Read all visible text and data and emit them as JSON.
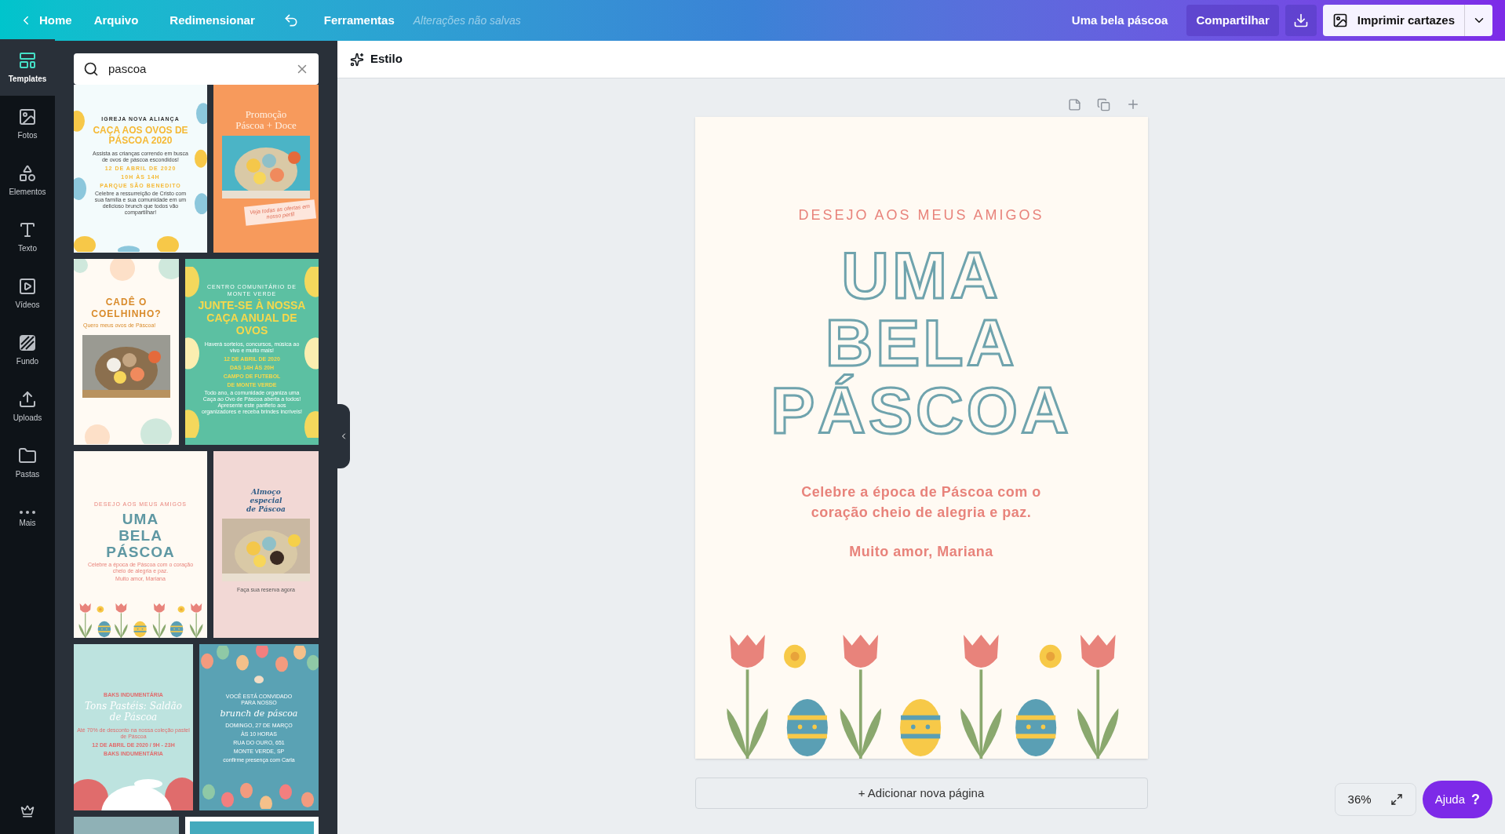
{
  "topbar": {
    "back": "Home",
    "menu": [
      "Arquivo",
      "Redimensionar"
    ],
    "tools": "Ferramentas",
    "save_status": "Alterações não salvas",
    "doc_title": "Uma bela páscoa",
    "share": "Compartilhar",
    "print": "Imprimir cartazes"
  },
  "rail": [
    {
      "label": "Templates",
      "selected": true
    },
    {
      "label": "Fotos",
      "selected": false
    },
    {
      "label": "Elementos",
      "selected": false
    },
    {
      "label": "Texto",
      "selected": false
    },
    {
      "label": "Vídeos",
      "selected": false
    },
    {
      "label": "Fundo",
      "selected": false
    },
    {
      "label": "Uploads",
      "selected": false
    },
    {
      "label": "Pastas",
      "selected": false
    },
    {
      "label": "Mais",
      "selected": false
    }
  ],
  "search": {
    "value": "pascoa"
  },
  "templates": [
    {
      "kind": "eggs-light",
      "lines": [
        {
          "kind": "eyebrow",
          "text": "IGREJA NOVA ALIANÇA"
        },
        {
          "kind": "title",
          "text": "CAÇA AOS OVOS DE PÁSCOA 2020"
        },
        {
          "kind": "body",
          "text": "Assista as crianças correndo em busca de ovos de páscoa escondidos!"
        },
        {
          "kind": "detail",
          "text": "12 DE ABRIL DE 2020"
        },
        {
          "kind": "detail",
          "text": "10H ÀS 14H"
        },
        {
          "kind": "detail",
          "text": "PARQUE SÃO BENEDITO"
        },
        {
          "kind": "body",
          "text": "Celebre a ressurreição de Cristo com sua família e sua comunidade em um delicioso brunch que todos vão compartilhar!"
        }
      ]
    },
    {
      "kind": "orange-photo",
      "lines": [
        {
          "kind": "title",
          "text": "Promoção Páscoa + Doce"
        },
        {
          "kind": "picture"
        },
        {
          "kind": "body",
          "text": "Veja todas as ofertas em nosso perfil"
        }
      ]
    },
    {
      "kind": "bunny-photo",
      "lines": [
        {
          "kind": "title",
          "text": "CADÊ O COELHINHO?"
        },
        {
          "kind": "body",
          "text": "Quero meus ovos de Páscoa!"
        },
        {
          "kind": "picture"
        }
      ]
    },
    {
      "kind": "green-eggs",
      "lines": [
        {
          "kind": "eyebrow",
          "text": "CENTRO COMUNITÁRIO DE MONTE VERDE"
        },
        {
          "kind": "title",
          "text": "JUNTE-SE À NOSSA CAÇA ANUAL DE OVOS"
        },
        {
          "kind": "body",
          "text": "Haverá sorteios, concursos, música ao vivo e muito mais!"
        },
        {
          "kind": "detail",
          "text": "12 DE ABRIL DE 2020"
        },
        {
          "kind": "detail",
          "text": "DAS 14H ÀS 20H"
        },
        {
          "kind": "detail",
          "text": "CAMPO DE FUTEBOL"
        },
        {
          "kind": "detail",
          "text": "DE MONTE VERDE"
        },
        {
          "kind": "body",
          "text": "Todo ano, a comunidade organiza uma Caça ao Ovo de Páscoa aberta a todos! Apresente este panfleto aos organizadores e receba brindes incríveis!"
        }
      ]
    },
    {
      "kind": "tulips",
      "lines": [
        {
          "kind": "eyebrow",
          "text": "DESEJO AOS MEUS AMIGOS"
        },
        {
          "kind": "title",
          "text": "UMA BELA PÁSCOA"
        },
        {
          "kind": "body",
          "text": "Celebre a época de Páscoa com o coração cheio de alegria e paz."
        },
        {
          "kind": "body",
          "text": "Muito amor, Mariana"
        }
      ]
    },
    {
      "kind": "brunch-photo",
      "lines": [
        {
          "kind": "title",
          "text": "Almoço especial de Páscoa"
        },
        {
          "kind": "picture"
        },
        {
          "kind": "body",
          "text": "Faça sua reserva agora"
        }
      ]
    },
    {
      "kind": "mint-bunny",
      "lines": [
        {
          "kind": "eyebrow",
          "text": "BAKS INDUMENTÁRIA"
        },
        {
          "kind": "title",
          "text": "Tons Pastéis: Saldão de Páscoa"
        },
        {
          "kind": "body",
          "text": "Até 70% de desconto na nossa coleção pastel de Páscoa"
        },
        {
          "kind": "detail",
          "text": "12 DE ABRIL DE 2020 / 9H - 23H"
        },
        {
          "kind": "detail",
          "text": "BAKS INDUMENTÁRIA"
        }
      ]
    },
    {
      "kind": "blue-eggs",
      "lines": [
        {
          "kind": "eyebrow",
          "text": "VOCÊ ESTÁ CONVIDADO PARA NOSSO"
        },
        {
          "kind": "title",
          "text": "brunch de páscoa"
        },
        {
          "kind": "detail",
          "text": "DOMINGO, 27 DE MARÇO"
        },
        {
          "kind": "detail",
          "text": "ÀS 10 HORAS"
        },
        {
          "kind": "detail",
          "text": "RUA DO OURO, 651"
        },
        {
          "kind": "detail",
          "text": "MONTE VERDE, SP"
        },
        {
          "kind": "body",
          "text": "confirme presença com Carla"
        }
      ]
    },
    {
      "kind": "teal-gray"
    },
    {
      "kind": "teal-frame"
    }
  ],
  "toolbar": {
    "style": "Estilo"
  },
  "page": {
    "eyebrow": "DESEJO AOS MEUS AMIGOS",
    "title_lines": [
      "UMA",
      "BELA",
      "PÁSCOA"
    ],
    "body": [
      "Celebre a época de Páscoa com o",
      "coração cheio de alegria e paz."
    ],
    "signature": "Muito amor, Mariana"
  },
  "add_page": "+ Adicionar nova página",
  "zoom": "36%",
  "help": "Ajuda",
  "help_icon": "?"
}
